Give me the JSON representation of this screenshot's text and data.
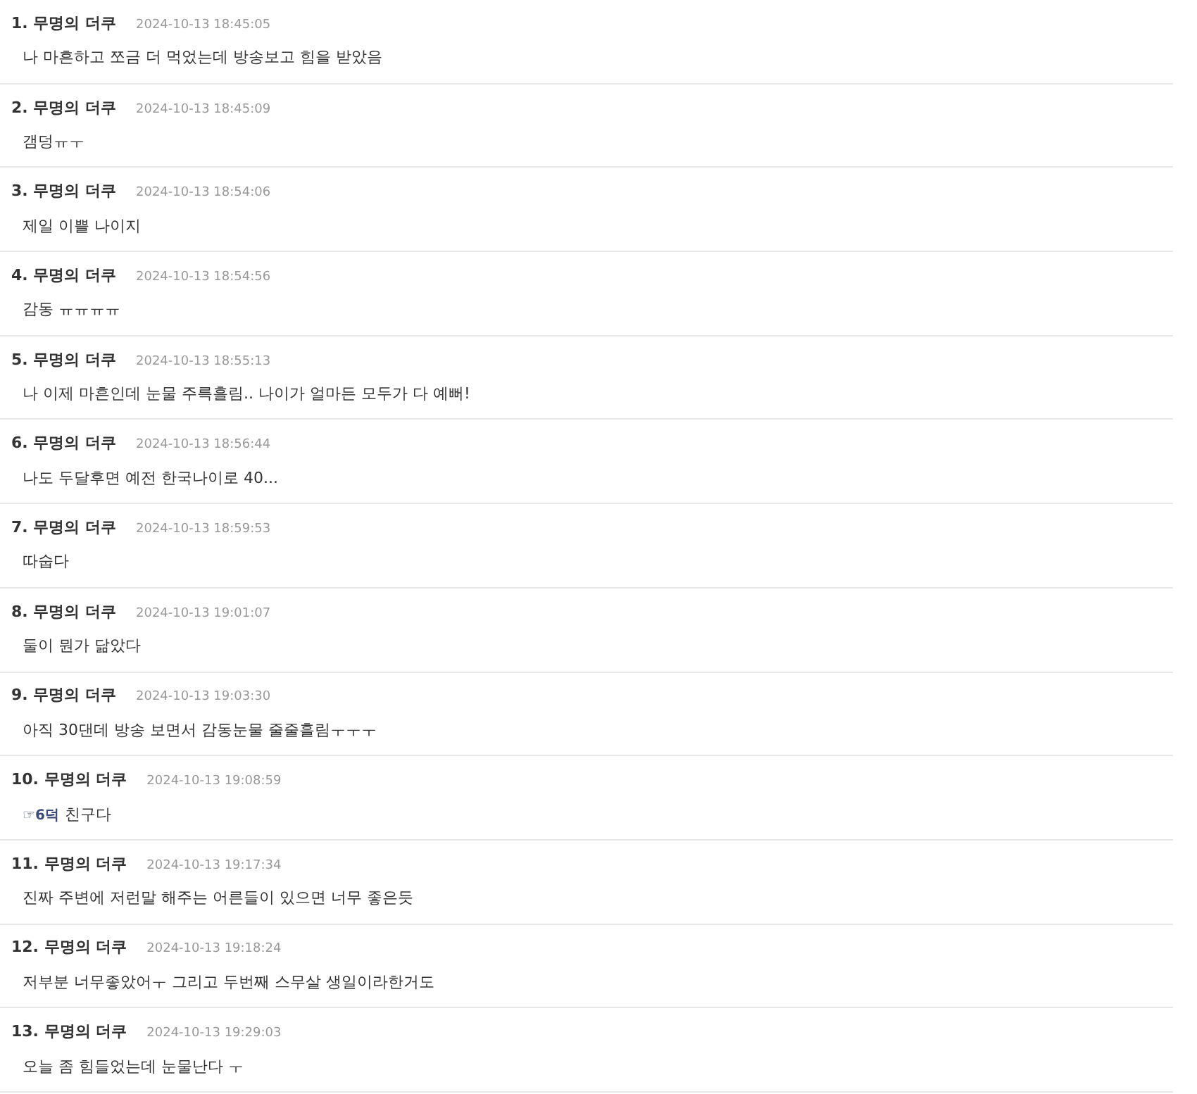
{
  "comments": [
    {
      "number": "1.",
      "author": "무명의 더쿠",
      "time": "2024-10-13 18:45:05",
      "text": "나 마흔하고 쪼금 더 먹었는데 방송보고 힘을 받았음"
    },
    {
      "number": "2.",
      "author": "무명의 더쿠",
      "time": "2024-10-13 18:45:09",
      "text": "갬덩ㅠㅜ"
    },
    {
      "number": "3.",
      "author": "무명의 더쿠",
      "time": "2024-10-13 18:54:06",
      "text": "제일 이쁠 나이지"
    },
    {
      "number": "4.",
      "author": "무명의 더쿠",
      "time": "2024-10-13 18:54:56",
      "text": "감동 ㅠㅠㅠㅠ"
    },
    {
      "number": "5.",
      "author": "무명의 더쿠",
      "time": "2024-10-13 18:55:13",
      "text": "나 이제 마흔인데 눈물 주륵흘림.. 나이가 얼마든 모두가 다 예뻐!"
    },
    {
      "number": "6.",
      "author": "무명의 더쿠",
      "time": "2024-10-13 18:56:44",
      "text": "나도 두달후면 예전 한국나이로 40..."
    },
    {
      "number": "7.",
      "author": "무명의 더쿠",
      "time": "2024-10-13 18:59:53",
      "text": "따숩다"
    },
    {
      "number": "8.",
      "author": "무명의 더쿠",
      "time": "2024-10-13 19:01:07",
      "text": "둘이 뭔가 닮았다"
    },
    {
      "number": "9.",
      "author": "무명의 더쿠",
      "time": "2024-10-13 19:03:30",
      "text": "아직 30댄데 방송 보면서 감동눈물 줄줄흘림ㅜㅜㅜ"
    },
    {
      "number": "10.",
      "author": "무명의 더쿠",
      "time": "2024-10-13 19:08:59",
      "reply_to": "☞6덕",
      "text": "친구다"
    },
    {
      "number": "11.",
      "author": "무명의 더쿠",
      "time": "2024-10-13 19:17:34",
      "text": "진짜 주변에 저런말 해주는 어른들이 있으면 너무 좋은듯"
    },
    {
      "number": "12.",
      "author": "무명의 더쿠",
      "time": "2024-10-13 19:18:24",
      "text": "저부분 너무좋았어ㅜ 그리고 두번째 스무살 생일이라한거도"
    },
    {
      "number": "13.",
      "author": "무명의 더쿠",
      "time": "2024-10-13 19:29:03",
      "text": "오늘 좀 힘들었는데 눈물난다 ㅜ"
    }
  ]
}
